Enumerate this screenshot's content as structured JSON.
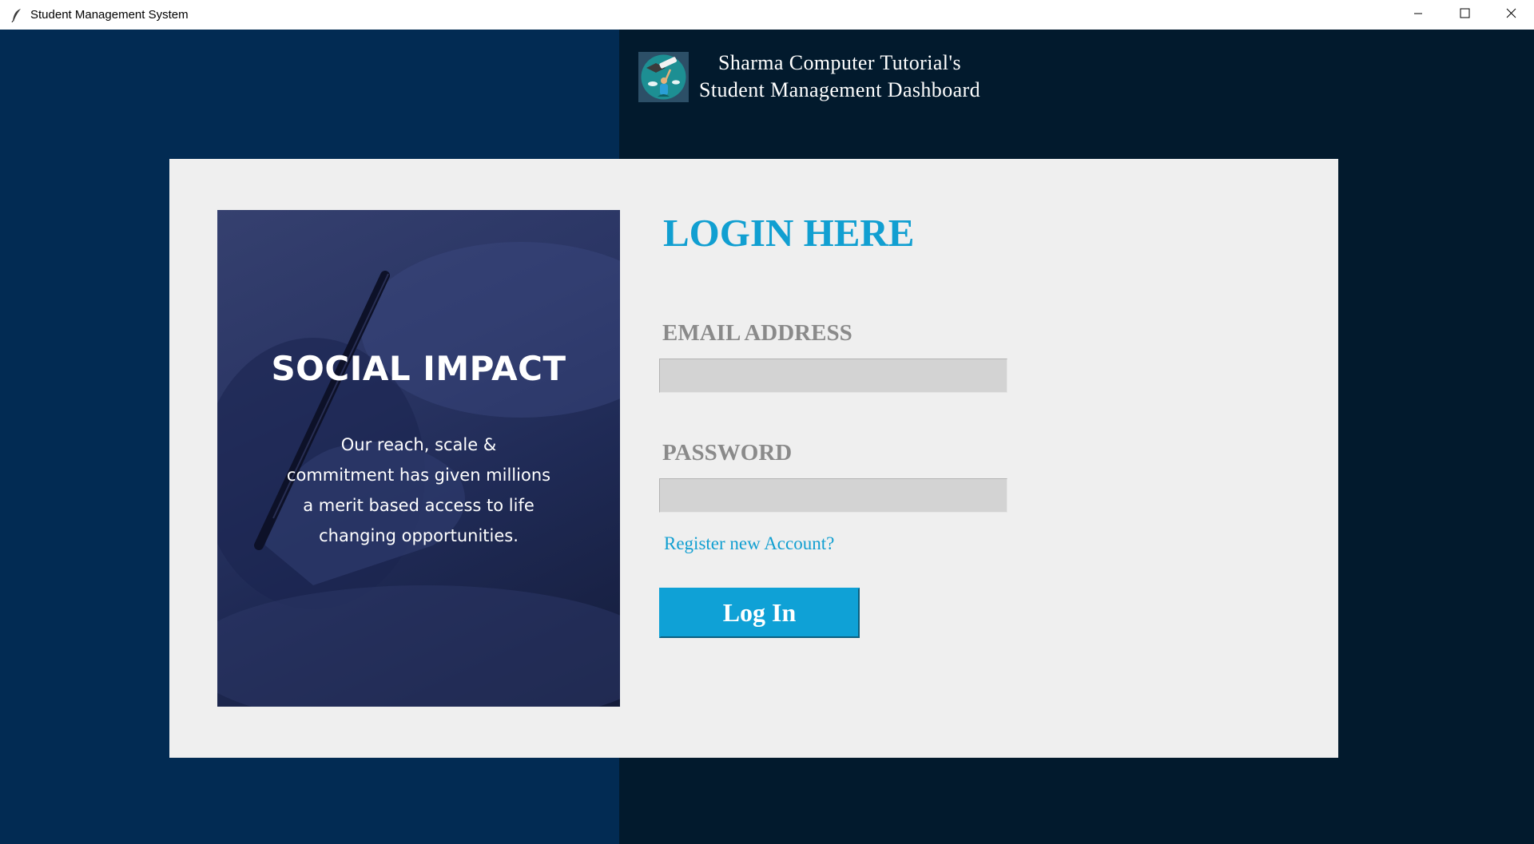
{
  "window": {
    "title": "Student Management System",
    "app_icon": "feather-icon",
    "controls": [
      "minimize-icon",
      "maximize-icon",
      "close-icon"
    ]
  },
  "header": {
    "line1": "Sharma Computer Tutorial's",
    "line2": "Student Management Dashboard",
    "logo_icon": "graduate-telescope-icon"
  },
  "promo": {
    "title": "SOCIAL IMPACT",
    "body_lines": [
      "Our reach, scale &",
      "commitment has given millions",
      "a merit based access to life",
      "changing opportunities."
    ]
  },
  "login": {
    "heading": "LOGIN HERE",
    "email_label": "EMAIL ADDRESS",
    "email_value": "",
    "password_label": "PASSWORD",
    "password_value": "",
    "register_link": "Register new Account?",
    "login_button": "Log In"
  },
  "colors": {
    "left_bg": "#022b53",
    "right_bg": "#021a2d",
    "card_bg": "#efefef",
    "accent": "#119fd1",
    "label_gray": "#8a8a8a",
    "input_bg": "#d3d3d3"
  }
}
